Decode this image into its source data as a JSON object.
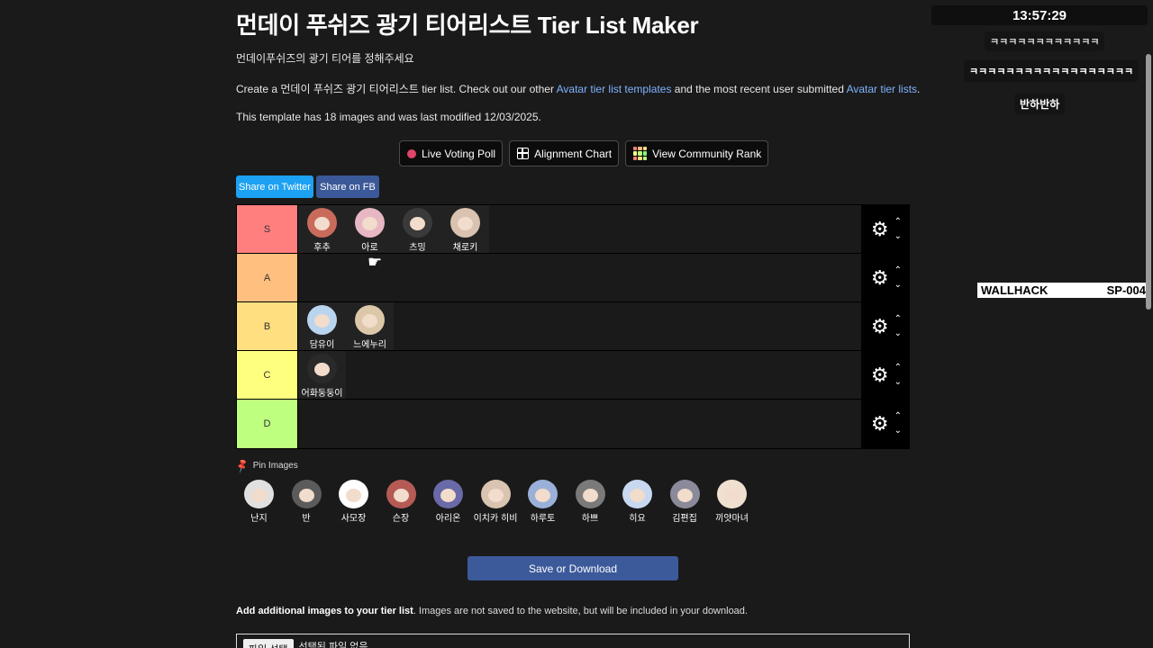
{
  "header": {
    "title": "먼데이 푸쉬즈 광기 티어리스트 Tier List Maker",
    "subtitle": "먼데이푸쉬즈의 광기 티어를 정해주세요",
    "desc_pre": "Create a 먼데이 푸쉬즈 광기 티어리스트 tier list. Check out our other ",
    "desc_link1": "Avatar tier list templates",
    "desc_mid": " and the most recent user submitted ",
    "desc_link2": "Avatar tier lists",
    "desc_post": ".",
    "meta": "This template has 18 images and was last modified 12/03/2025."
  },
  "actions": {
    "live_poll": "Live Voting Poll",
    "alignment": "Alignment Chart",
    "community": "View Community Rank",
    "share_twitter": "Share on Twitter",
    "share_fb": "Share on FB"
  },
  "colors": {
    "S": "#ff7f7f",
    "A": "#ffbf7f",
    "B": "#ffdf7f",
    "C": "#ffff7f",
    "D": "#bfff7f",
    "accent": "#3c5a9a",
    "twitter": "#1da1f2",
    "facebook": "#3b5998"
  },
  "tiers": [
    {
      "label": "S",
      "items": [
        "후추",
        "아로",
        "츠밍",
        "채로키"
      ]
    },
    {
      "label": "A",
      "items": []
    },
    {
      "label": "B",
      "items": [
        "담유이",
        "느에누리"
      ]
    },
    {
      "label": "C",
      "items": [
        "어화둥둥이"
      ]
    },
    {
      "label": "D",
      "items": []
    }
  ],
  "pin": {
    "label": "Pin Images",
    "items": [
      "난지",
      "반",
      "사모장",
      "슨장",
      "아리온",
      "이치카 히비",
      "하루토",
      "하쁘",
      "히요",
      "김편집",
      "끼얏마녀"
    ]
  },
  "save_label": "Save or Download",
  "add_bold": "Add additional images to your tier list",
  "add_rest": ". Images are not saved to the website, but will be included in your download.",
  "file": {
    "button": "파일 선택",
    "status": "선택된 파일 없음"
  },
  "overlay": {
    "clock": "13:57:29",
    "chat1": "ㅋㅋㅋㅋㅋㅋㅋㅋㅋㅋㅋㅋ",
    "chat2": "ㅋㅋㅋㅋㅋㅋㅋㅋㅋㅋㅋㅋㅋㅋㅋㅋㅋㅋ",
    "chat3": "반하반하",
    "wallhack_left": "WALLHACK",
    "wallhack_right": "SP-004"
  }
}
